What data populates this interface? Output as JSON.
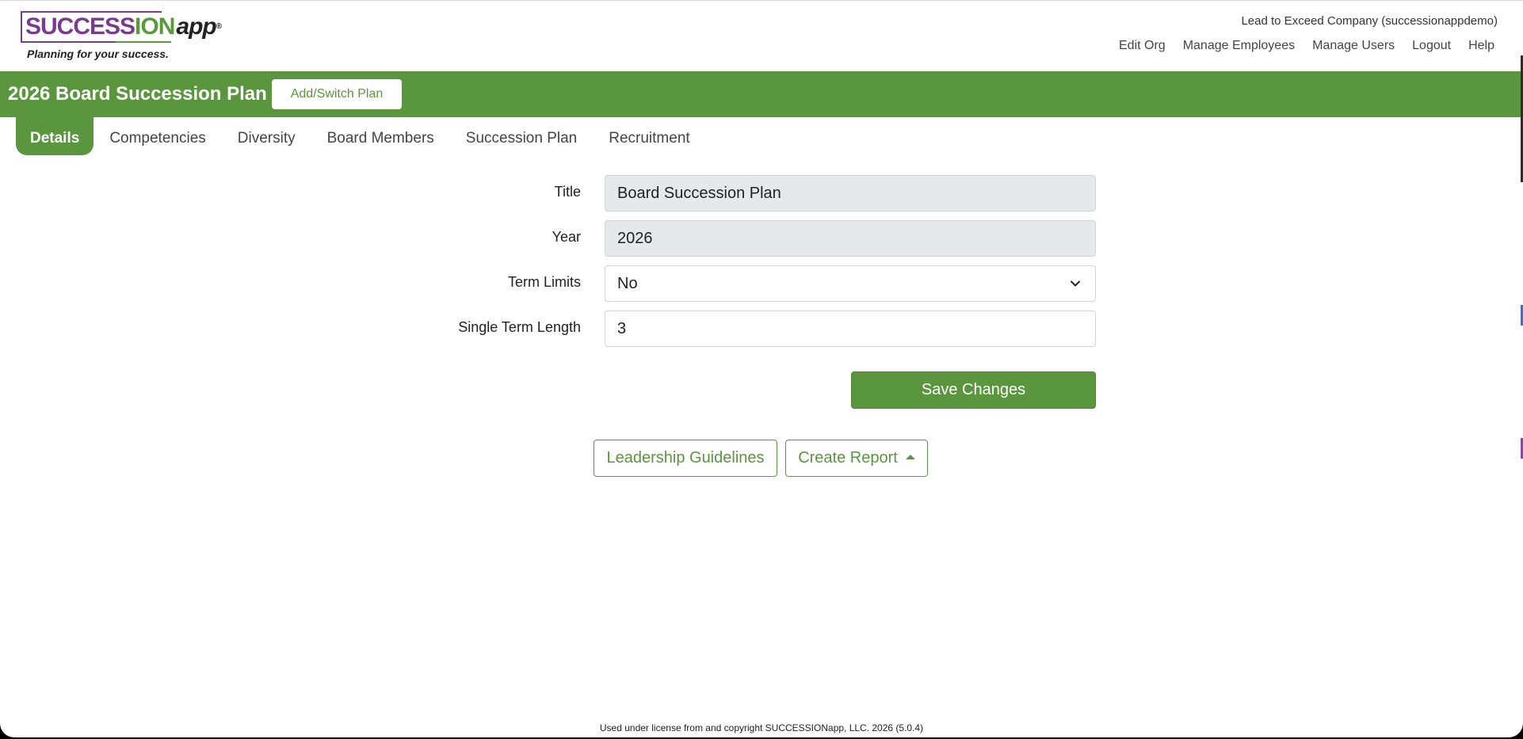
{
  "header": {
    "logo": {
      "text_succ": "SUCCESS",
      "text_ion": "ION",
      "text_app": "app",
      "registered": "®",
      "tagline": "Planning for your success."
    },
    "company": "Lead to Exceed Company (successionappdemo)",
    "nav": {
      "edit_org": "Edit Org",
      "manage_employees": "Manage Employees",
      "manage_users": "Manage Users",
      "logout": "Logout",
      "help": "Help"
    }
  },
  "plan_bar": {
    "title": "2026 Board Succession Plan",
    "switch_label": "Add/Switch Plan"
  },
  "tabs": {
    "details": "Details",
    "competencies": "Competencies",
    "diversity": "Diversity",
    "board_members": "Board Members",
    "succession_plan": "Succession Plan",
    "recruitment": "Recruitment",
    "active": "Details"
  },
  "form": {
    "title_label": "Title",
    "title_value": "Board Succession Plan",
    "year_label": "Year",
    "year_value": "2026",
    "term_limits_label": "Term Limits",
    "term_limits_value": "No",
    "term_length_label": "Single Term Length",
    "term_length_value": "3",
    "save_label": "Save Changes"
  },
  "actions": {
    "leadership_guidelines": "Leadership Guidelines",
    "create_report": "Create Report"
  },
  "footer": "Used under license from and copyright SUCCESSIONapp, LLC. 2026 (5.0.4)",
  "colors": {
    "brand_green": "#5a963d",
    "brand_purple": "#7a3b8f"
  }
}
